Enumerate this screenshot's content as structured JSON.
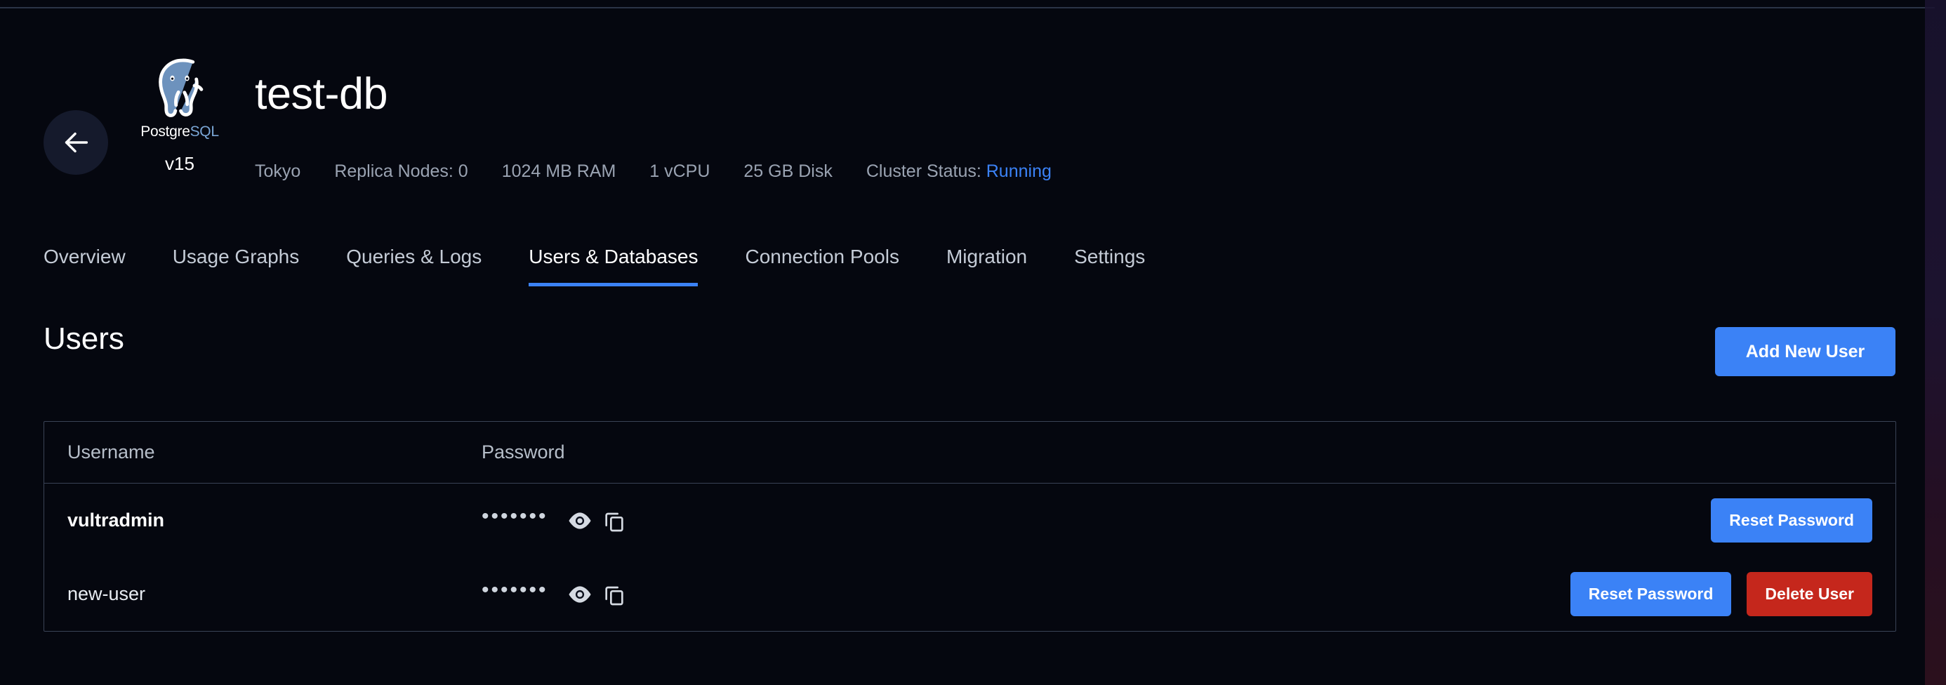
{
  "window": {
    "accent_blue": "#3b82f6",
    "danger_red": "#c5271c",
    "background": "#05070f",
    "border": "#3a4356"
  },
  "header": {
    "back_icon": "arrow-left-icon",
    "engine": {
      "logo_icon": "postgresql-elephant-icon",
      "wordmark_first": "Postgre",
      "wordmark_second": "SQL",
      "version": "v15"
    },
    "title": "test-db",
    "meta": [
      {
        "label": "Tokyo"
      },
      {
        "label": "Replica Nodes: 0"
      },
      {
        "label": "1024 MB RAM"
      },
      {
        "label": "1 vCPU"
      },
      {
        "label": "25 GB Disk"
      }
    ],
    "status_label": "Cluster Status:",
    "status_value": "Running"
  },
  "tabs": [
    {
      "label": "Overview",
      "active": false
    },
    {
      "label": "Usage Graphs",
      "active": false
    },
    {
      "label": "Queries & Logs",
      "active": false
    },
    {
      "label": "Users & Databases",
      "active": true
    },
    {
      "label": "Connection Pools",
      "active": false
    },
    {
      "label": "Migration",
      "active": false
    },
    {
      "label": "Settings",
      "active": false
    }
  ],
  "section": {
    "title": "Users",
    "add_user_label": "Add New User"
  },
  "table": {
    "columns": [
      "Username",
      "Password"
    ],
    "rows": [
      {
        "username": "vultradmin",
        "bold": true,
        "password_mask": "•••••••",
        "reveal_icon": "eye-icon",
        "copy_icon": "copy-icon",
        "actions": [
          {
            "label": "Reset Password",
            "style": "reset"
          }
        ]
      },
      {
        "username": "new-user",
        "bold": false,
        "password_mask": "•••••••",
        "reveal_icon": "eye-icon",
        "copy_icon": "copy-icon",
        "actions": [
          {
            "label": "Reset Password",
            "style": "reset"
          },
          {
            "label": "Delete User",
            "style": "delete"
          }
        ]
      }
    ]
  }
}
